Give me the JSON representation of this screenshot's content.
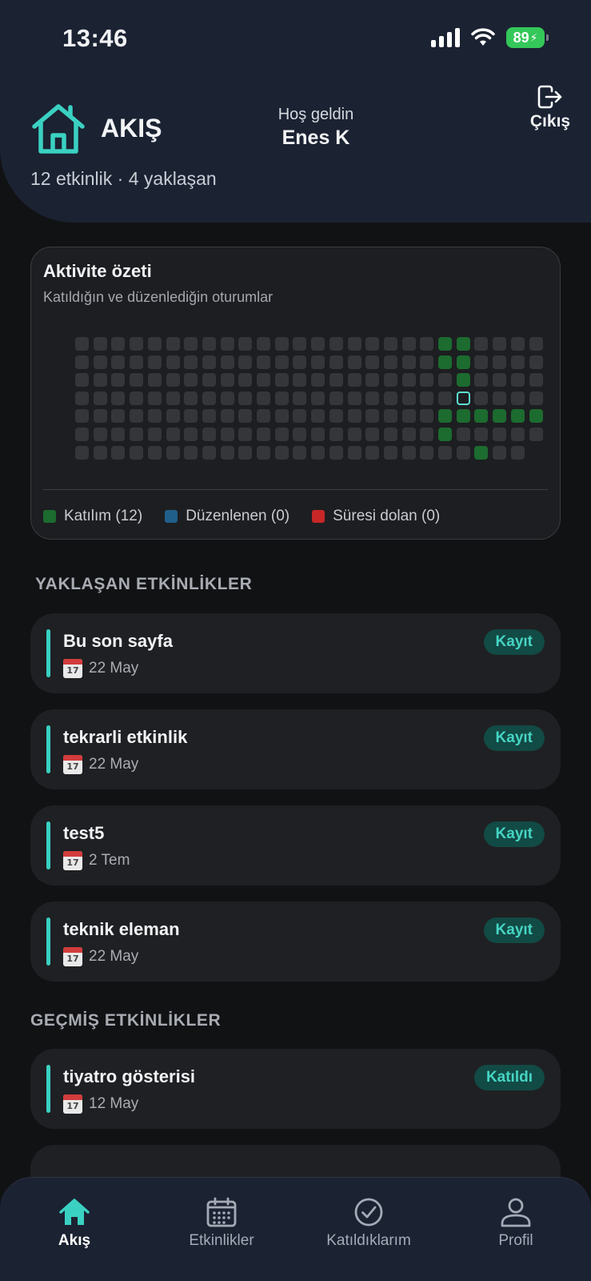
{
  "status_bar": {
    "time": "13:46",
    "battery": "89"
  },
  "header": {
    "title": "AKIŞ",
    "subtitle": "12 etkinlik · 4 yaklaşan",
    "welcome_label": "Hoş geldin",
    "user_name": "Enes K",
    "logout_label": "Çıkış"
  },
  "activity": {
    "title": "Aktivite özeti",
    "subtitle": "Katıldığın ve düzenlediğin oturumlar",
    "legend": [
      {
        "label": "Katılım (12)",
        "color": "#1c6b2f"
      },
      {
        "label": "Düzenlenen (0)",
        "color": "#1f5f8a"
      },
      {
        "label": "Süresi dolan (0)",
        "color": "#c72727"
      }
    ],
    "colors": {
      "empty": "#34363a",
      "attended": "#1c6b2f",
      "today": "#5ce0d2"
    },
    "weeks": 26,
    "days_per_week": 7,
    "attended_cells": [
      [
        20,
        0
      ],
      [
        20,
        1
      ],
      [
        20,
        4
      ],
      [
        20,
        5
      ],
      [
        21,
        0
      ],
      [
        21,
        1
      ],
      [
        21,
        2
      ],
      [
        21,
        4
      ],
      [
        22,
        4
      ],
      [
        22,
        6
      ],
      [
        23,
        4
      ],
      [
        24,
        4
      ],
      [
        25,
        4
      ]
    ],
    "today_cell": [
      21,
      3
    ],
    "missing_cells": [
      [
        25,
        6
      ]
    ]
  },
  "upcoming": {
    "title": "YAKLAŞAN ETKİNLİKLER",
    "events": [
      {
        "name": "Bu son sayfa",
        "date": "22 May",
        "badge": "Kayıt"
      },
      {
        "name": "tekrarli etkinlik",
        "date": "22 May",
        "badge": "Kayıt"
      },
      {
        "name": "test5",
        "date": "2 Tem",
        "badge": "Kayıt"
      },
      {
        "name": "teknik eleman",
        "date": "22 May",
        "badge": "Kayıt"
      }
    ]
  },
  "past": {
    "title": "GEÇMİŞ ETKİNLİKLER",
    "events": [
      {
        "name": "tiyatro gösterisi",
        "date": "12 May",
        "badge": "Katıldı"
      }
    ]
  },
  "calendar_emoji_day": "17",
  "bottom_nav": [
    {
      "label": "Akış",
      "icon": "home-icon",
      "active": true
    },
    {
      "label": "Etkinlikler",
      "icon": "calendar-icon",
      "active": false
    },
    {
      "label": "Katıldıklarım",
      "icon": "check-circle-icon",
      "active": false
    },
    {
      "label": "Profil",
      "icon": "user-icon",
      "active": false
    }
  ]
}
